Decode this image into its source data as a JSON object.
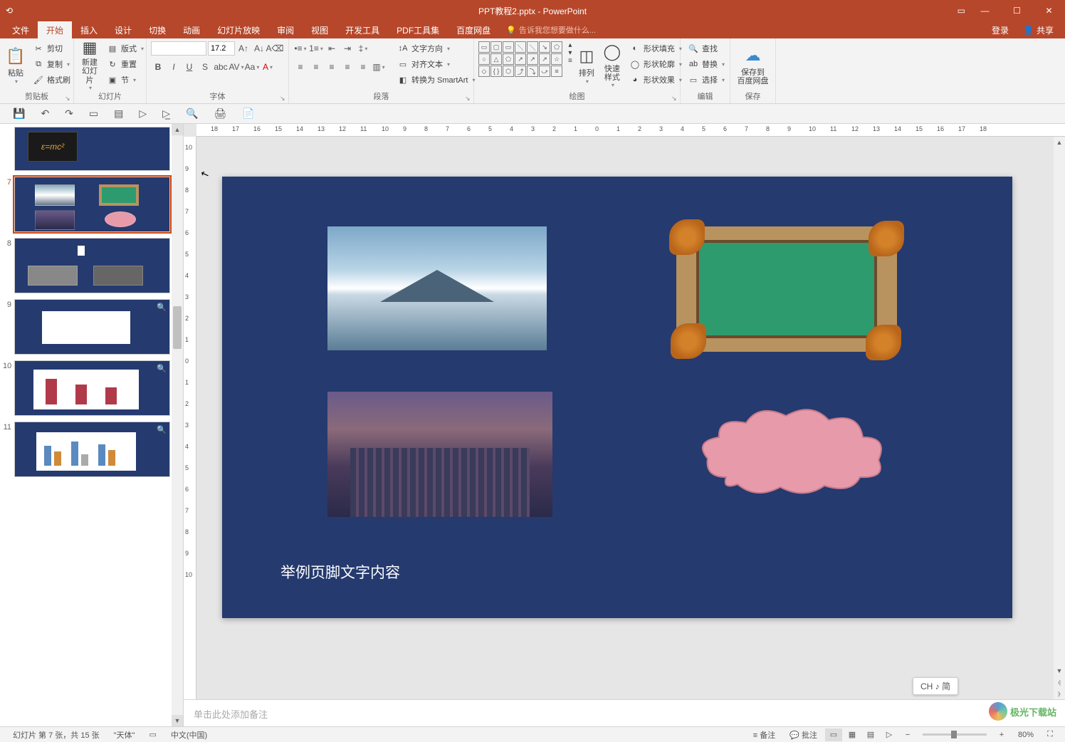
{
  "title": "PPT教程2.pptx - PowerPoint",
  "tabs": {
    "file": "文件",
    "home": "开始",
    "insert": "插入",
    "design": "设计",
    "transitions": "切换",
    "animations": "动画",
    "slideshow": "幻灯片放映",
    "review": "审阅",
    "view": "视图",
    "developer": "开发工具",
    "pdftools": "PDF工具集",
    "baidu": "百度网盘"
  },
  "tellme": "告诉我您想要做什么...",
  "account": {
    "signin": "登录",
    "share": "共享"
  },
  "ribbon": {
    "clipboard": {
      "label": "剪贴板",
      "paste": "粘贴",
      "cut": "剪切",
      "copy": "复制",
      "formatpainter": "格式刷"
    },
    "slides": {
      "label": "幻灯片",
      "newslide": "新建\n幻灯片",
      "layout": "版式",
      "reset": "重置",
      "section": "节"
    },
    "font": {
      "label": "字体",
      "name": "",
      "size": "17.2"
    },
    "paragraph": {
      "label": "段落",
      "textdir": "文字方向",
      "aligntext": "对齐文本",
      "smartart": "转换为 SmartArt"
    },
    "drawing": {
      "label": "绘图",
      "arrange": "排列",
      "quickstyle": "快速样式",
      "shapefill": "形状填充",
      "shapeoutline": "形状轮廓",
      "shapeeffects": "形状效果"
    },
    "editing": {
      "label": "编辑",
      "find": "查找",
      "replace": "替换",
      "select": "选择"
    },
    "save": {
      "label": "保存",
      "savebaidu": "保存到\n百度网盘"
    }
  },
  "thumbnails": {
    "items": [
      {
        "num": ""
      },
      {
        "num": "7"
      },
      {
        "num": "8"
      },
      {
        "num": "9"
      },
      {
        "num": "10"
      },
      {
        "num": "11"
      }
    ]
  },
  "slide": {
    "footer": "举例页脚文字内容"
  },
  "ruler_h": [
    "18",
    "17",
    "16",
    "15",
    "14",
    "13",
    "12",
    "11",
    "10",
    "9",
    "8",
    "7",
    "6",
    "5",
    "4",
    "3",
    "2",
    "1",
    "0",
    "1",
    "2",
    "3",
    "4",
    "5",
    "6",
    "7",
    "8",
    "9",
    "10",
    "11",
    "12",
    "13",
    "14",
    "15",
    "16",
    "17",
    "18"
  ],
  "ruler_v": [
    "10",
    "9",
    "8",
    "7",
    "6",
    "5",
    "4",
    "3",
    "2",
    "1",
    "0",
    "1",
    "2",
    "3",
    "4",
    "5",
    "6",
    "7",
    "8",
    "9",
    "10"
  ],
  "notes": {
    "placeholder": "单击此处添加备注"
  },
  "ime": "CH ♪ 简",
  "status": {
    "slideinfo": "幻灯片 第 7 张，共 15 张",
    "theme": "\"天体\"",
    "lang": "中文(中国)",
    "notesbtn": "备注",
    "commentsbtn": "批注",
    "zoom": "80%"
  },
  "watermark": "极光下载站"
}
